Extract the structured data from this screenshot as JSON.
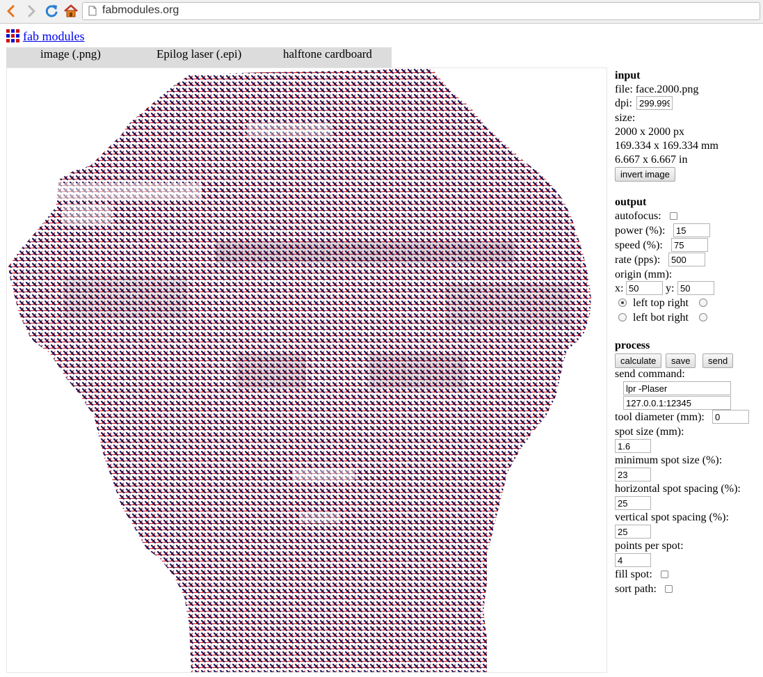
{
  "browser": {
    "url": "fabmodules.org"
  },
  "app": {
    "brand_label": "fab modules"
  },
  "tabs": [
    {
      "label": "image (.png)"
    },
    {
      "label": "Epilog laser (.epi)"
    },
    {
      "label": "halftone cardboard"
    }
  ],
  "input": {
    "heading": "input",
    "file_label": "file: face.2000.png",
    "dpi_label": "dpi:",
    "dpi_value": "299.999",
    "size_label": "size:",
    "size_px": "2000 x 2000 px",
    "size_mm": "169.334 x 169.334 mm",
    "size_in": "6.667 x 6.667 in",
    "invert_label": "invert image"
  },
  "output": {
    "heading": "output",
    "autofocus_label": "autofocus:",
    "power_label": "power (%):",
    "power_value": "15",
    "speed_label": "speed (%):",
    "speed_value": "75",
    "rate_label": "rate (pps):",
    "rate_value": "500",
    "origin_label": "origin (mm):",
    "x_label": "x:",
    "x_value": "50",
    "y_label": "y:",
    "y_value": "50",
    "origin_row1": "left top right",
    "origin_row2": "left bot right"
  },
  "process": {
    "heading": "process",
    "calculate_label": "calculate",
    "save_label": "save",
    "send_label": "send",
    "send_command_label": "send command:",
    "send_command_value": "lpr -Plaser",
    "server_value": "127.0.0.1:12345",
    "tool_diameter_label": "tool diameter (mm):",
    "tool_diameter_value": "0",
    "spot_size_label": "spot size (mm):",
    "spot_size_value": "1.6",
    "min_spot_label": "minimum spot size (%):",
    "min_spot_value": "23",
    "hspacing_label": "horizontal spot spacing (%):",
    "hspacing_value": "25",
    "vspacing_label": "vertical spot spacing (%):",
    "vspacing_value": "25",
    "points_label": "points per spot:",
    "points_value": "4",
    "fill_label": "fill spot:",
    "sort_label": "sort path:"
  },
  "colors": {
    "path": "#cc1f2a",
    "spot": "#1a1a5e",
    "link": "#0000ee",
    "tabbar": "#dcdcdc"
  }
}
